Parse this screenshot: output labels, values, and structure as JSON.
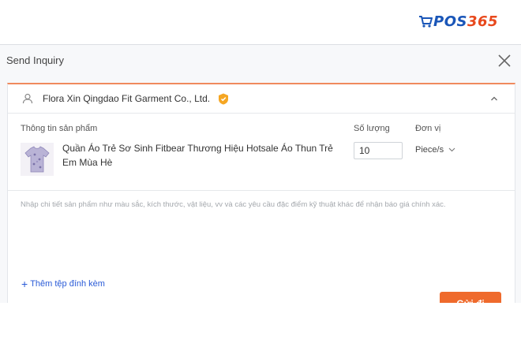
{
  "brand": {
    "part1": "POS",
    "part2": "365",
    "colors": {
      "primary": "#1a56b8",
      "accent": "#e8491d"
    }
  },
  "dialog": {
    "title": "Send Inquiry",
    "close_icon": "close-icon",
    "supplier": {
      "name": "Flora Xin Qingdao Fit Garment Co., Ltd.",
      "user_icon": "user-icon",
      "badge_icon": "gold-supplier-badge-icon",
      "collapse_icon": "chevron-up-icon"
    },
    "columns": {
      "product_info": "Thông tin sản phẩm",
      "quantity": "Số lượng",
      "unit": "Đơn vị"
    },
    "product": {
      "name": "Quần Áo Trẻ Sơ Sinh Fitbear Thương Hiệu Hotsale Áo Thun Trẻ Em Mùa Hè",
      "quantity": "10",
      "unit": "Piece/s",
      "thumbnail_icon": "tshirt-thumbnail"
    },
    "details": {
      "placeholder": "Nhập chi tiết sản phẩm như màu sắc, kích thước, vật liệu, vv và các yêu cầu đặc điểm kỹ thuật khác để nhận báo giá chính xác."
    },
    "attach_label": "Thêm tệp đính kèm",
    "send_label": "Gửi đi",
    "accent_color": "#ef6a2c",
    "link_color": "#2a5bd7"
  }
}
